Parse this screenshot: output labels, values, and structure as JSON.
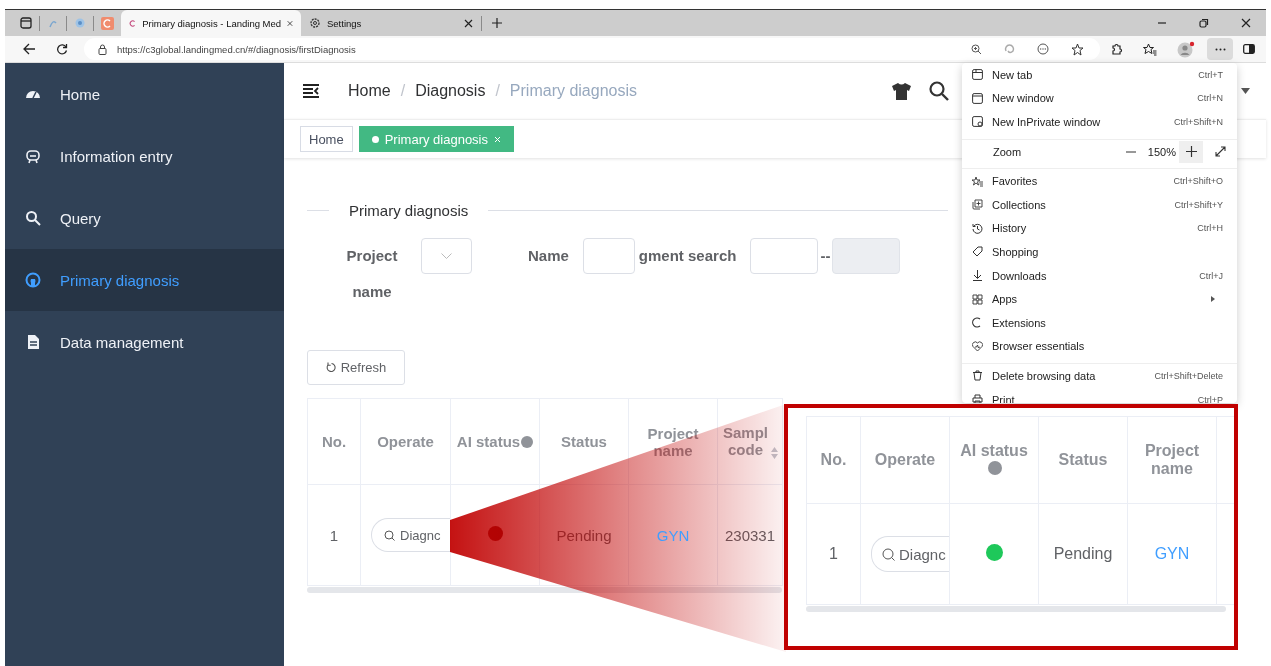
{
  "browser": {
    "tabs": [
      {
        "title": "Primary diagnosis - Landing Med",
        "selected": true
      },
      {
        "title": "Settings",
        "selected": false
      }
    ],
    "url": "https://c3global.landingmed.cn/#/diagnosis/firstDiagnosis"
  },
  "sidebar": {
    "items": [
      {
        "label": "Home",
        "selected": false
      },
      {
        "label": "Information entry",
        "selected": false
      },
      {
        "label": "Query",
        "selected": false
      },
      {
        "label": "Primary diagnosis",
        "selected": true
      },
      {
        "label": "Data management",
        "selected": false
      }
    ]
  },
  "breadcrumbs": [
    {
      "label": "Home",
      "current": false,
      "separator": "/"
    },
    {
      "label": "Diagnosis",
      "current": false,
      "separator": "/"
    },
    {
      "label": "Primary diagnosis",
      "current": true
    }
  ],
  "tags": [
    {
      "label": "Home",
      "selected": false
    },
    {
      "label": "Primary diagnosis",
      "selected": true
    }
  ],
  "section_title": "Primary diagnosis",
  "filters": [
    {
      "kind": "select",
      "label": "Project name"
    },
    {
      "kind": "input",
      "label": "Name"
    },
    {
      "kind": "range",
      "label": "gment search",
      "separator": "--",
      "end_disabled": true
    }
  ],
  "refresh_button": "Refresh",
  "table": {
    "columns": [
      {
        "label": "No."
      },
      {
        "label": "Operate"
      },
      {
        "label": "AI status",
        "info": true
      },
      {
        "label": "Status"
      },
      {
        "label": "Project name"
      },
      {
        "label": "Sampl code",
        "sortable": true
      }
    ],
    "rows": [
      {
        "no": "1",
        "operate": "Diagnc",
        "status": "Pending",
        "project": "GYN",
        "sample_code": "230331"
      }
    ]
  },
  "menu": {
    "items": [
      {
        "kind": "item",
        "label": "New tab",
        "shortcut": "Ctrl+T"
      },
      {
        "kind": "item",
        "label": "New window",
        "shortcut": "Ctrl+N"
      },
      {
        "kind": "item",
        "label": "New InPrivate window",
        "shortcut": "Ctrl+Shift+N"
      },
      {
        "kind": "divider"
      },
      {
        "kind": "zoom",
        "label": "Zoom",
        "value": "150%"
      },
      {
        "kind": "divider"
      },
      {
        "kind": "item",
        "label": "Favorites",
        "shortcut": "Ctrl+Shift+O"
      },
      {
        "kind": "item",
        "label": "Collections",
        "shortcut": "Ctrl+Shift+Y"
      },
      {
        "kind": "item",
        "label": "History",
        "shortcut": "Ctrl+H"
      },
      {
        "kind": "item",
        "label": "Shopping"
      },
      {
        "kind": "item",
        "label": "Downloads",
        "shortcut": "Ctrl+J"
      },
      {
        "kind": "item",
        "label": "Apps",
        "submenu": true
      },
      {
        "kind": "item",
        "label": "Extensions"
      },
      {
        "kind": "item",
        "label": "Browser essentials"
      },
      {
        "kind": "divider"
      },
      {
        "kind": "item",
        "label": "Delete browsing data",
        "shortcut": "Ctrl+Shift+Delete"
      },
      {
        "kind": "item",
        "label": "Print",
        "shortcut": "Ctrl+P"
      }
    ]
  },
  "callout": {
    "columns": [
      {
        "label": "No."
      },
      {
        "label": "Operate"
      },
      {
        "label": "AI status",
        "info": true
      },
      {
        "label": "Status"
      },
      {
        "label": "Project name"
      }
    ],
    "rows": [
      {
        "no": "1",
        "operate": "Diagnc",
        "ai_status": {
          "color": "#1ec85a"
        },
        "status": "Pending",
        "project": "GYN"
      }
    ]
  }
}
